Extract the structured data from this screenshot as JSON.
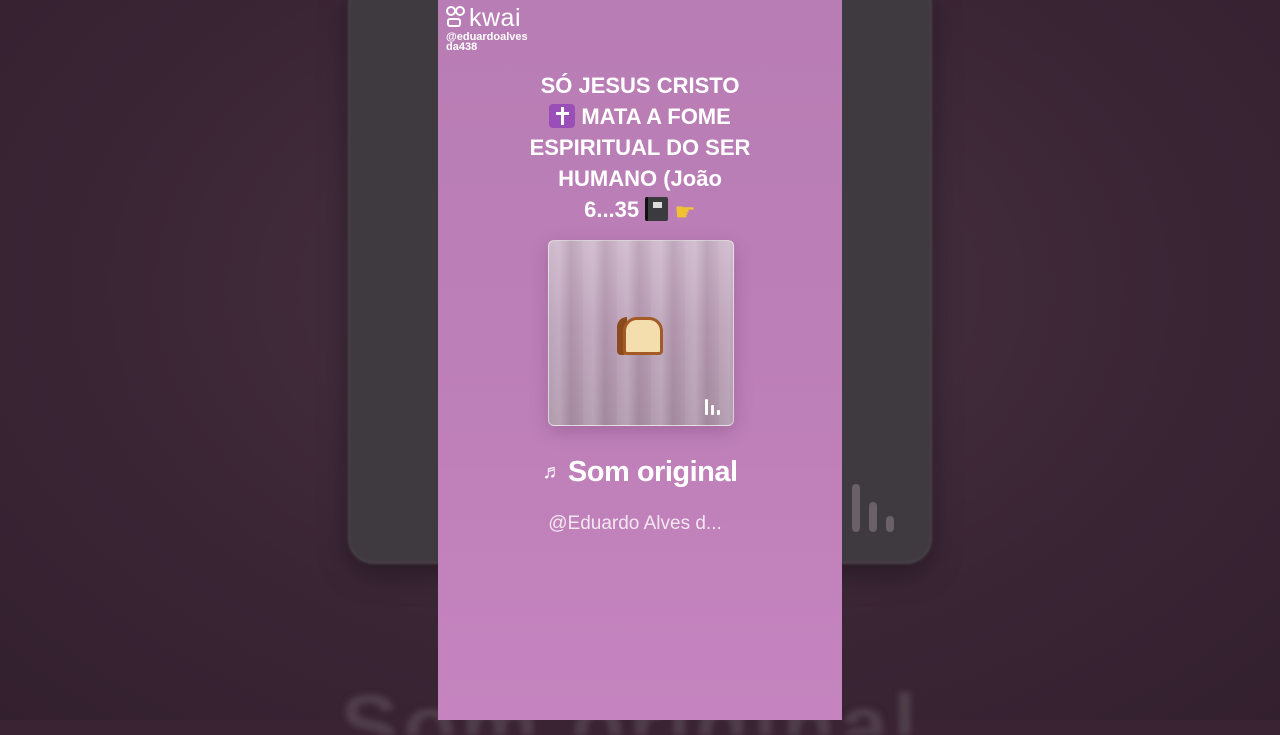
{
  "brand": {
    "name": "kwai",
    "handle": "@eduardoalvesda438"
  },
  "caption": {
    "line1": "SÓ JESUS CRISTO",
    "line2_icon": "latin-cross-emoji",
    "line2": "MATA A FOME",
    "line3": "ESPIRITUAL DO SER",
    "line4": "HUMANO (João",
    "line5": "6...35",
    "line5_icons": [
      "notebook-emoji",
      "backhand-pointing-left-emoji"
    ]
  },
  "artwork": {
    "icon": "bread-emoji",
    "indicator": "audio-bars-icon"
  },
  "sound": {
    "note": "♬",
    "title": "Som original",
    "author": "@Eduardo Alves d..."
  },
  "colors": {
    "panel": "#bd7fb8",
    "backdrop": "#3a2434",
    "text": "#ffffff"
  }
}
